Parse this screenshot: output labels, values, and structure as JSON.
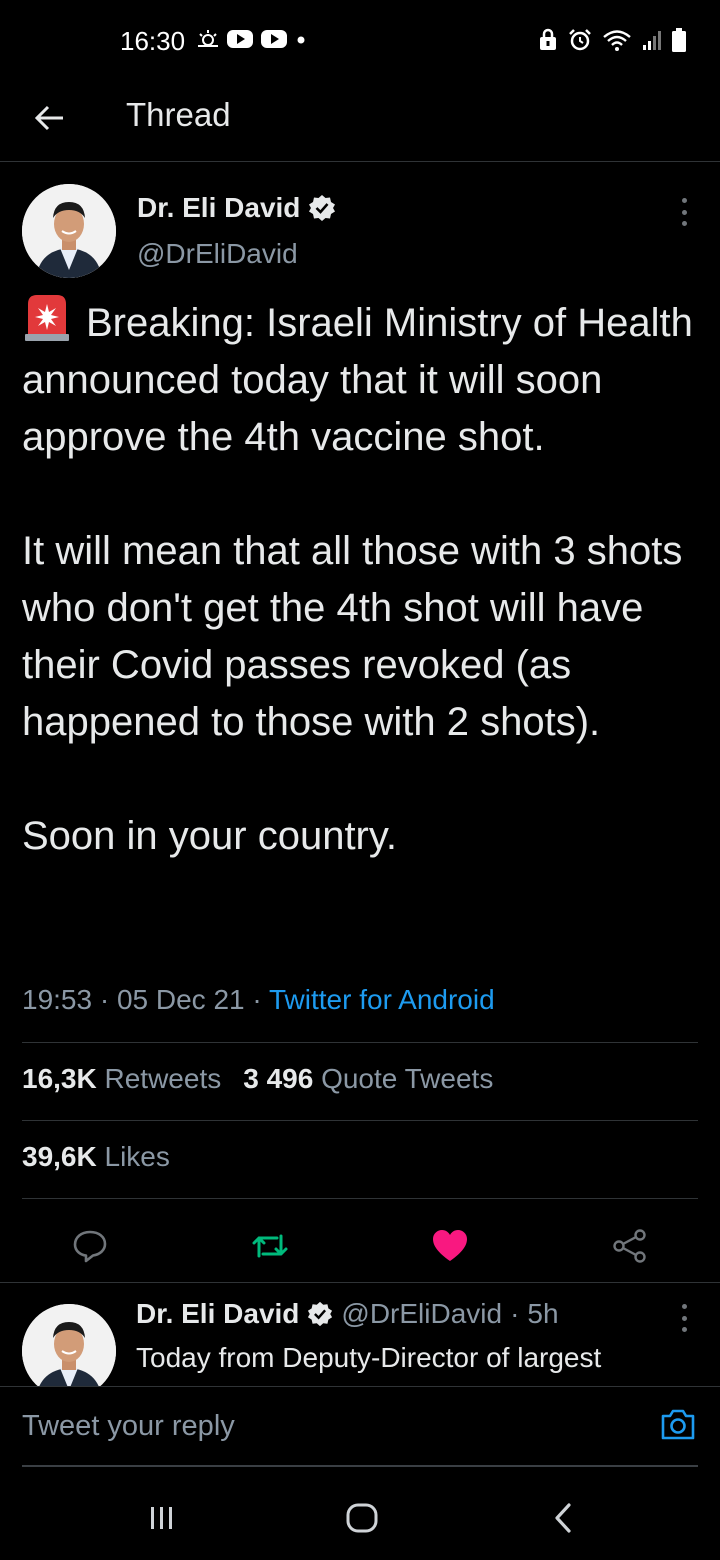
{
  "status_bar": {
    "time": "16:30",
    "left_icons": [
      "weather-icon",
      "youtube-icon",
      "youtube-icon",
      "notification-dot-icon"
    ],
    "right_icons": [
      "lock-icon",
      "alarm-icon",
      "wifi-icon",
      "signal-icon",
      "battery-icon"
    ]
  },
  "header": {
    "title": "Thread",
    "back_icon": "arrow-left-icon"
  },
  "tweet": {
    "author_name": "Dr. Eli David",
    "author_handle": "@DrEliDavid",
    "verified": true,
    "paragraphs": [
      "Breaking: Israeli Ministry of Health announced today that it will soon approve the 4th vaccine shot.",
      "It will mean that all those with 3 shots who don't get the 4th shot will have their Covid passes revoked (as happened to those with 2 shots).",
      "Soon in your country."
    ],
    "time": "19:53",
    "date": "05 Dec 21",
    "source": "Twitter for Android",
    "retweets_count": "16,3K",
    "retweets_label": "Retweets",
    "quotes_count": "3 496",
    "quotes_label": "Quote Tweets",
    "likes_count": "39,6K",
    "likes_label": "Likes",
    "liked": true,
    "colors": {
      "retweet": "#00ba7c",
      "like": "#f91880",
      "link": "#1d9bf0"
    }
  },
  "reply": {
    "author_name": "Dr. Eli David",
    "author_handle": "@DrEliDavid",
    "time_ago": "5h",
    "text": "Today from Deputy-Director of largest"
  },
  "composer": {
    "placeholder": "Tweet your reply"
  },
  "nav": {
    "recent_icon": "recent-apps-icon",
    "home_icon": "home-icon",
    "back_icon": "back-icon"
  }
}
